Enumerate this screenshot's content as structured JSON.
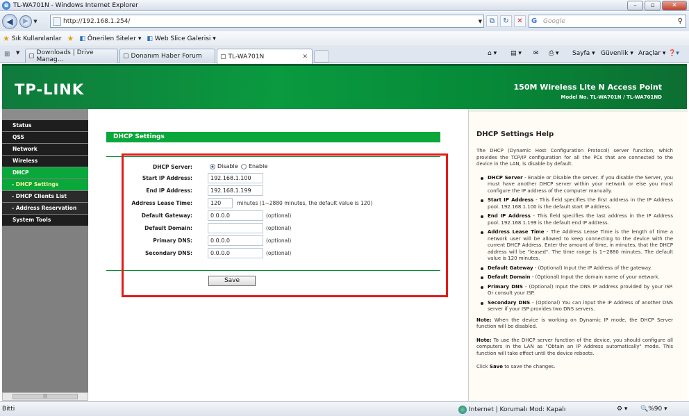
{
  "window": {
    "title": "TL-WA701N - Windows Internet Explorer"
  },
  "address": {
    "url": "http://192.168.1.254/"
  },
  "search": {
    "placeholder": "Google"
  },
  "favorites": {
    "label": "Sık Kullanılanlar",
    "items": [
      "Önerilen Siteler ▾",
      "Web Slice Galerisi ▾"
    ]
  },
  "tabs": [
    {
      "label": "Downloads | Drive Manag..."
    },
    {
      "label": "Donanım Haber Forum"
    },
    {
      "label": "TL-WA701N"
    }
  ],
  "commands": {
    "page": "Sayfa ▾",
    "security": "Güvenlik ▾",
    "tools": "Araçlar ▾"
  },
  "banner": {
    "logo": "TP-LINK",
    "product": "150M Wireless Lite N Access Point",
    "model": "Model No. TL-WA701N / TL-WA701ND"
  },
  "menu": [
    {
      "label": "Status",
      "sub": false,
      "active": false
    },
    {
      "label": "QSS",
      "sub": false,
      "active": false
    },
    {
      "label": "Network",
      "sub": false,
      "active": false
    },
    {
      "label": "Wireless",
      "sub": false,
      "active": false
    },
    {
      "label": "DHCP",
      "sub": false,
      "active": true
    },
    {
      "label": "- DHCP Settings",
      "sub": true,
      "active": true
    },
    {
      "label": "- DHCP Clients List",
      "sub": true,
      "active": false
    },
    {
      "label": "- Address Reservation",
      "sub": true,
      "active": false
    },
    {
      "label": "System Tools",
      "sub": false,
      "active": false
    }
  ],
  "form": {
    "title": "DHCP Settings",
    "dhcp_server_label": "DHCP Server:",
    "disable": "Disable",
    "enable": "Enable",
    "start_ip_label": "Start IP Address:",
    "start_ip": "192.168.1.100",
    "end_ip_label": "End IP Address:",
    "end_ip": "192.168.1.199",
    "lease_label": "Address Lease Time:",
    "lease": "120",
    "lease_hint": "minutes (1~2880 minutes, the default value is 120)",
    "gateway_label": "Default Gateway:",
    "gateway": "0.0.0.0",
    "domain_label": "Default Domain:",
    "domain": "",
    "primary_dns_label": "Primary DNS:",
    "primary_dns": "0.0.0.0",
    "secondary_dns_label": "Secondary DNS:",
    "secondary_dns": "0.0.0.0",
    "optional": "(optional)",
    "save": "Save"
  },
  "help": {
    "title": "DHCP Settings Help",
    "intro": "The DHCP (Dynamic Host Configuration Protocol) server function, which provides the TCP/IP configuration for all the PCs that are connected to the device in the LAN, is disable by default.",
    "items": [
      {
        "term": "DHCP Server",
        "text": " - Enable or Disable the server. If you disable the Server, you must have another DHCP server within your network or else you must configure the IP address of the computer manually."
      },
      {
        "term": "Start IP Address",
        "text": " - This field specifies the first address in the IP Address pool. 192.168.1.100 is the default start IP address."
      },
      {
        "term": "End IP Address",
        "text": " - This field specifies the last address in the IP Address pool. 192.168.1.199 is the default end IP address."
      },
      {
        "term": "Address Lease Time",
        "text": " - The Address Lease Time is the length of time a network user will be allowed to keep connecting to the device with the current DHCP Address. Enter the amount of time, in minutes, that the DHCP address will be \"leased\". The time range is 1~2880 minutes. The default value is 120 minutes."
      },
      {
        "term": "Default Gateway",
        "text": " - (Optional) Input the IP Address of the gateway."
      },
      {
        "term": "Default Domain",
        "text": " - (Optional) Input the domain name of your network."
      },
      {
        "term": "Primary DNS",
        "text": " - (Optional) Input the DNS IP address provided by your ISP. Or consult your ISP."
      },
      {
        "term": "Secondary DNS",
        "text": " - (Optional) You can input the IP Address of another DNS server if your ISP provides two DNS servers."
      }
    ],
    "note1_label": "Note:",
    "note1": " When the device is working on Dynamic IP mode, the DHCP Server function will be disabled.",
    "note2_label": "Note:",
    "note2": " To use the DHCP server function of the device, you should configure all computers in the LAN as \"Obtain an IP Address automatically\" mode. This function will take effect until the device reboots.",
    "click_pre": "Click ",
    "click_save": "Save",
    "click_post": " to save the changes."
  },
  "status": {
    "left": "Bitti",
    "zone": "Internet | Korumalı Mod: Kapalı",
    "zoom": "%90"
  }
}
